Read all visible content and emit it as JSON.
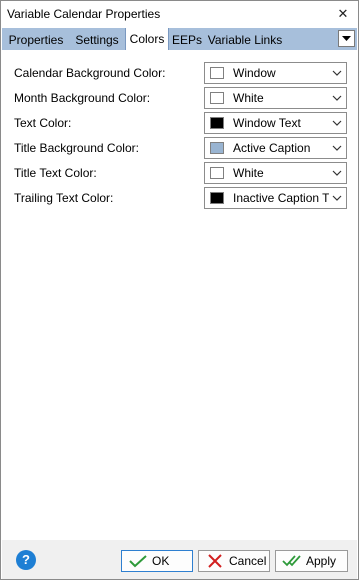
{
  "window": {
    "title": "Variable Calendar Properties",
    "close_glyph": "✕"
  },
  "tabs": [
    {
      "label": "Properties"
    },
    {
      "label": "Settings"
    },
    {
      "label": "Colors",
      "active": true
    },
    {
      "label": "EEPs"
    },
    {
      "label": "Variable Links"
    }
  ],
  "rows": [
    {
      "label": "Calendar Background Color:",
      "value": "Window",
      "swatch": "#ffffff"
    },
    {
      "label": "Month Background Color:",
      "value": "White",
      "swatch": "#ffffff"
    },
    {
      "label": "Text Color:",
      "value": "Window Text",
      "swatch": "#000000"
    },
    {
      "label": "Title Background Color:",
      "value": "Active Caption",
      "swatch": "#99b4d1"
    },
    {
      "label": "Title Text Color:",
      "value": "White",
      "swatch": "#ffffff"
    },
    {
      "label": "Trailing Text Color:",
      "value": "Inactive Caption T",
      "swatch": "#000000"
    }
  ],
  "footer": {
    "help_glyph": "?",
    "ok_label": "OK",
    "cancel_label": "Cancel",
    "apply_label": "Apply"
  },
  "colors": {
    "tab_strip": "#a7bfdb",
    "help_icon": "#1e7fd4",
    "ok_check": "#2e9a3a",
    "cancel_x": "#d21f1f"
  }
}
